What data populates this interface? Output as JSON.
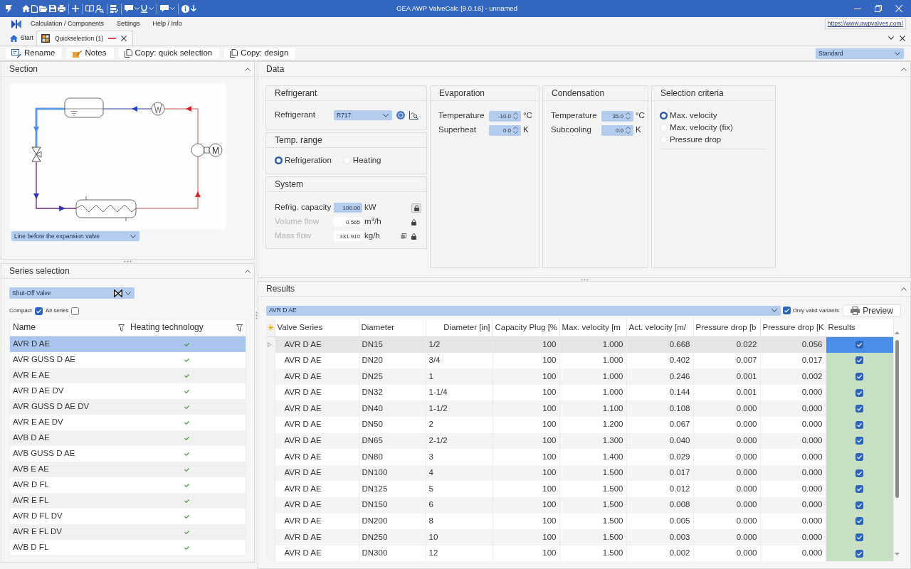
{
  "window": {
    "title": "GEA AWP ValveCalc [9.0.16] - unnamed"
  },
  "menu": [
    {
      "label": "Calculation / Components"
    },
    {
      "label": "Settings"
    },
    {
      "label": "Help / Info"
    }
  ],
  "website_link": "https://www.awpvalves.com/",
  "document_tabs": [
    {
      "kind": "home",
      "label": "Start",
      "selected": false
    },
    {
      "kind": "document",
      "label": "Quickselection (1)",
      "selected": true
    }
  ],
  "command_bar": {
    "buttons": [
      {
        "label": "Rename"
      },
      {
        "label": "Notes"
      },
      {
        "label": "Copy: quick selection"
      },
      {
        "label": "Copy: design"
      }
    ],
    "layout": "Standard"
  },
  "section": {
    "title": "Section",
    "diagram": {
      "motor_label": "M"
    },
    "line": "Line before the expansion valve"
  },
  "series_selection": {
    "title": "Series selection",
    "valve_type": "Shut-Off Valve",
    "filters": [
      {
        "label": "Compact",
        "checked": true
      },
      {
        "label": "All series",
        "checked": false
      }
    ],
    "columns": [
      "Name",
      "Heating technology"
    ],
    "rows": [
      {
        "name": "AVR D AE",
        "heating_technology": true,
        "selected": true
      },
      {
        "name": "AVR GUSS D AE",
        "heating_technology": true,
        "selected": false
      },
      {
        "name": "AVR E AE",
        "heating_technology": true,
        "selected": false
      },
      {
        "name": "AVR D AE DV",
        "heating_technology": true,
        "selected": false
      },
      {
        "name": "AVR GUSS D AE DV",
        "heating_technology": true,
        "selected": false
      },
      {
        "name": "AVR E AE DV",
        "heating_technology": true,
        "selected": false
      },
      {
        "name": "AVB D AE",
        "heating_technology": true,
        "selected": false
      },
      {
        "name": "AVB GUSS D AE",
        "heating_technology": true,
        "selected": false
      },
      {
        "name": "AVB E AE",
        "heating_technology": true,
        "selected": false
      },
      {
        "name": "AVR D FL",
        "heating_technology": true,
        "selected": false
      },
      {
        "name": "AVR E FL",
        "heating_technology": true,
        "selected": false
      },
      {
        "name": "AVR D FL DV",
        "heating_technology": true,
        "selected": false
      },
      {
        "name": "AVR E FL DV",
        "heating_technology": true,
        "selected": false
      },
      {
        "name": "AVB D FL",
        "heating_technology": true,
        "selected": false
      }
    ]
  },
  "data": {
    "title": "Data",
    "refrigerant": {
      "title": "Refrigerant",
      "label": "Refrigerant",
      "value": "R717"
    },
    "temp_range": {
      "title": "Temp. range",
      "options": [
        {
          "label": "Refrigeration",
          "selected": true
        },
        {
          "label": "Heating",
          "selected": false
        }
      ]
    },
    "system": {
      "title": "System",
      "fields": [
        {
          "label": "Refrig. capacity",
          "value": "100.00",
          "unit": "kW",
          "disabled": false,
          "copy_button": false
        },
        {
          "label": "Volume flow",
          "value": "0.565",
          "unit": "m$^{3}$/h",
          "disabled": true,
          "copy_button": false
        },
        {
          "label": "Mass flow",
          "value": "331.910",
          "unit": "kg/h",
          "disabled": true,
          "copy_button": true
        }
      ]
    },
    "evaporation": {
      "title": "Evaporation",
      "fields": [
        {
          "label": "Temperature",
          "value": "-10.0",
          "unit": "°C"
        },
        {
          "label": "Superheat",
          "value": "0.0",
          "unit": "K"
        }
      ]
    },
    "condensation": {
      "title": "Condensation",
      "fields": [
        {
          "label": "Temperature",
          "value": "35.0",
          "unit": "°C"
        },
        {
          "label": "Subcooling",
          "value": "0.0",
          "unit": "K"
        }
      ]
    },
    "selection_criteria": {
      "title": "Selection criteria",
      "options": [
        {
          "label": "Max. velocity",
          "selected": true
        },
        {
          "label": "Max. velocity (fix)",
          "selected": false
        },
        {
          "label": "Pressure drop",
          "selected": false
        }
      ]
    }
  },
  "results": {
    "title": "Results",
    "series": "AVR D AE",
    "only_valid": {
      "label": "Only valid variants",
      "checked": true
    },
    "preview": "Preview",
    "columns": [
      "Valve Series",
      "Diameter",
      "Diameter [in]",
      "Capacity Plug [%",
      "Max. velocity [m",
      "Act. velocity [m/",
      "Pressure drop [b",
      "Pressure drop [K",
      "Results"
    ],
    "rows": [
      {
        "cells": [
          "AVR D AE",
          "DN15",
          "1/2",
          "100",
          "1.000",
          "0.668",
          "0.022",
          "0.056"
        ],
        "checked": true,
        "selected": true
      },
      {
        "cells": [
          "AVR D AE",
          "DN20",
          "3/4",
          "100",
          "1.000",
          "0.402",
          "0.007",
          "0.017"
        ],
        "checked": true,
        "selected": false
      },
      {
        "cells": [
          "AVR D AE",
          "DN25",
          "1",
          "100",
          "1.000",
          "0.246",
          "0.001",
          "0.002"
        ],
        "checked": true,
        "selected": false
      },
      {
        "cells": [
          "AVR D AE",
          "DN32",
          "1-1/4",
          "100",
          "1.000",
          "0.144",
          "0.001",
          "0.000"
        ],
        "checked": true,
        "selected": false
      },
      {
        "cells": [
          "AVR D AE",
          "DN40",
          "1-1/2",
          "100",
          "1.100",
          "0.108",
          "0.000",
          "0.000"
        ],
        "checked": true,
        "selected": false
      },
      {
        "cells": [
          "AVR D AE",
          "DN50",
          "2",
          "100",
          "1.200",
          "0.067",
          "0.000",
          "0.000"
        ],
        "checked": true,
        "selected": false
      },
      {
        "cells": [
          "AVR D AE",
          "DN65",
          "2-1/2",
          "100",
          "1.300",
          "0.040",
          "0.000",
          "0.000"
        ],
        "checked": true,
        "selected": false
      },
      {
        "cells": [
          "AVR D AE",
          "DN80",
          "3",
          "100",
          "1.400",
          "0.029",
          "0.000",
          "0.000"
        ],
        "checked": true,
        "selected": false
      },
      {
        "cells": [
          "AVR D AE",
          "DN100",
          "4",
          "100",
          "1.500",
          "0.017",
          "0.000",
          "0.000"
        ],
        "checked": true,
        "selected": false
      },
      {
        "cells": [
          "AVR D AE",
          "DN125",
          "5",
          "100",
          "1.500",
          "0.012",
          "0.000",
          "0.000"
        ],
        "checked": true,
        "selected": false
      },
      {
        "cells": [
          "AVR D AE",
          "DN150",
          "6",
          "100",
          "1.500",
          "0.008",
          "0.000",
          "0.000"
        ],
        "checked": true,
        "selected": false
      },
      {
        "cells": [
          "AVR D AE",
          "DN200",
          "8",
          "100",
          "1.500",
          "0.005",
          "0.000",
          "0.000"
        ],
        "checked": true,
        "selected": false
      },
      {
        "cells": [
          "AVR D AE",
          "DN250",
          "10",
          "100",
          "1.500",
          "0.003",
          "0.000",
          "0.000"
        ],
        "checked": true,
        "selected": false
      },
      {
        "cells": [
          "AVR D AE",
          "DN300",
          "12",
          "100",
          "1.500",
          "0.002",
          "0.000",
          "0.000"
        ],
        "checked": true,
        "selected": false
      }
    ]
  }
}
